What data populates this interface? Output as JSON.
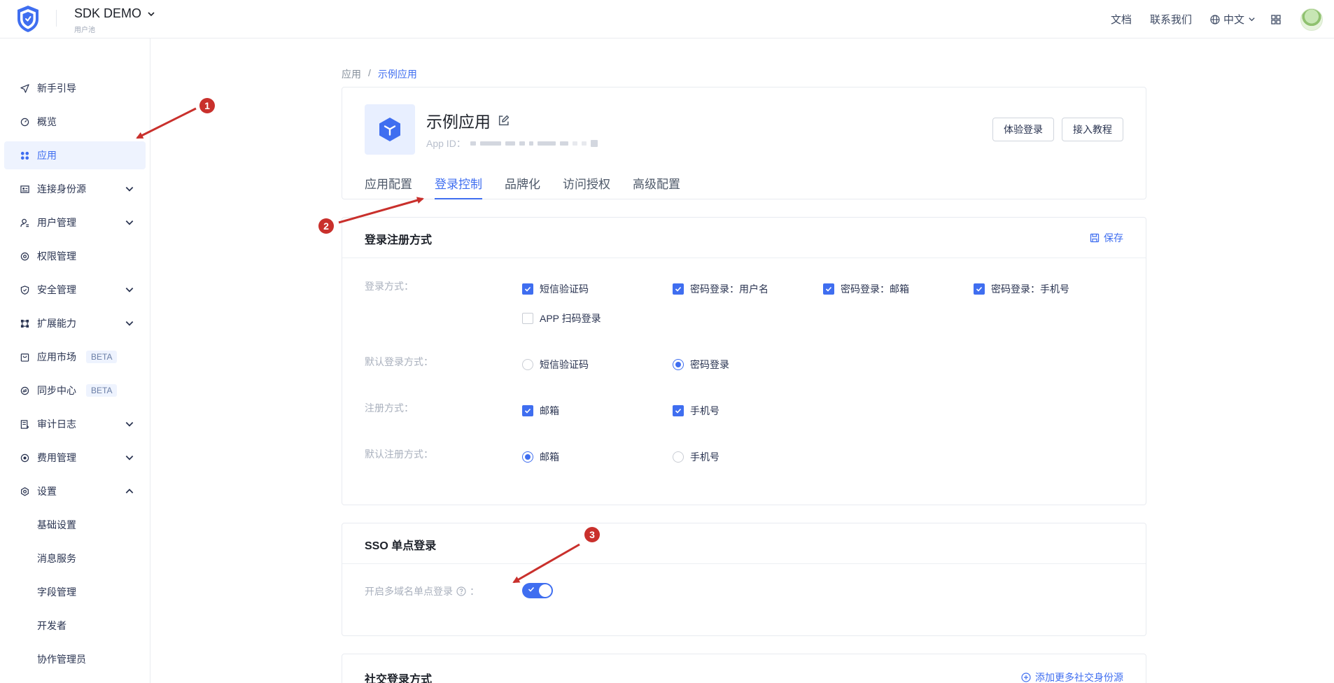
{
  "header": {
    "pool_name": "SDK DEMO",
    "pool_sub": "用户池",
    "links": {
      "docs": "文档",
      "contact": "联系我们"
    },
    "language": "中文"
  },
  "sidebar": {
    "items": [
      {
        "label": "新手引导",
        "icon": "send-icon"
      },
      {
        "label": "概览",
        "icon": "dashboard-icon"
      },
      {
        "label": "应用",
        "icon": "apps-icon",
        "active": true
      },
      {
        "label": "连接身份源",
        "icon": "id-card-icon"
      },
      {
        "label": "用户管理",
        "icon": "user-icon"
      },
      {
        "label": "权限管理",
        "icon": "lock-circle-icon"
      },
      {
        "label": "安全管理",
        "icon": "shield-icon"
      },
      {
        "label": "扩展能力",
        "icon": "extension-icon"
      },
      {
        "label": "应用市场",
        "icon": "market-icon",
        "badge": "BETA"
      },
      {
        "label": "同步中心",
        "icon": "sync-icon",
        "badge": "BETA"
      },
      {
        "label": "审计日志",
        "icon": "log-icon"
      },
      {
        "label": "费用管理",
        "icon": "billing-icon"
      },
      {
        "label": "设置",
        "icon": "settings-icon"
      }
    ],
    "settings_sub": [
      "基础设置",
      "消息服务",
      "字段管理",
      "开发者",
      "协作管理员"
    ]
  },
  "breadcrumb": {
    "root": "应用",
    "separator": "/",
    "current": "示例应用"
  },
  "app": {
    "name": "示例应用",
    "id_label": "App ID：",
    "buttons": {
      "try_login": "体验登录",
      "tutorial": "接入教程"
    },
    "tabs": [
      "应用配置",
      "登录控制",
      "品牌化",
      "访问授权",
      "高级配置"
    ],
    "active_tab": "登录控制"
  },
  "login_section": {
    "title": "登录注册方式",
    "save": "保存",
    "login_methods_label": "登录方式：",
    "login_methods": [
      {
        "label": "短信验证码",
        "checked": true
      },
      {
        "label": "密码登录：用户名",
        "checked": true
      },
      {
        "label": "密码登录：邮箱",
        "checked": true
      },
      {
        "label": "密码登录：手机号",
        "checked": true
      },
      {
        "label": "APP 扫码登录",
        "checked": false
      }
    ],
    "default_login_label": "默认登录方式：",
    "default_login": [
      {
        "label": "短信验证码",
        "selected": false
      },
      {
        "label": "密码登录",
        "selected": true
      }
    ],
    "register_label": "注册方式：",
    "register_methods": [
      {
        "label": "邮箱",
        "checked": true
      },
      {
        "label": "手机号",
        "checked": true
      }
    ],
    "default_register_label": "默认注册方式：",
    "default_register": [
      {
        "label": "邮箱",
        "selected": true
      },
      {
        "label": "手机号",
        "selected": false
      }
    ]
  },
  "sso_section": {
    "title": "SSO 单点登录",
    "toggle_label": "开启多域名单点登录",
    "toggle_suffix": "：",
    "enabled": true
  },
  "social_section": {
    "title": "社交登录方式",
    "add_link": "添加更多社交身份源"
  },
  "annotations": [
    "1",
    "2",
    "3"
  ],
  "colors": {
    "accent": "#3f6ef0",
    "annotation": "#c9302c"
  }
}
